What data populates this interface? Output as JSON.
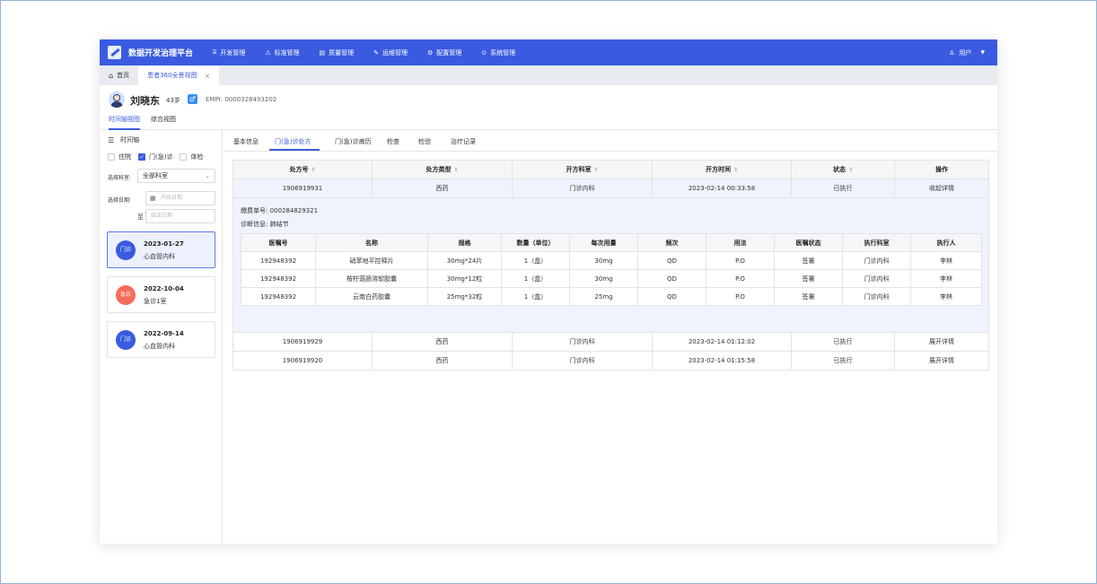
{
  "app": {
    "title": "数据开发治理平台",
    "nav": [
      {
        "label": "开发管理",
        "icon": "code-icon"
      },
      {
        "label": "标准管理",
        "icon": "standard-icon"
      },
      {
        "label": "质量管理",
        "icon": "quality-icon"
      },
      {
        "label": "运维管理",
        "icon": "wrench-icon"
      },
      {
        "label": "配置管理",
        "icon": "gear-icon"
      },
      {
        "label": "系统管理",
        "icon": "system-icon"
      }
    ],
    "user_label": "用户"
  },
  "page_tabs": {
    "home": "首页",
    "current": "患者360全景视图"
  },
  "patient": {
    "name": "刘晓东",
    "age": "43岁",
    "sex_symbol": "♂",
    "empi": "EMPI:  0000328493202"
  },
  "view_tabs": [
    "时间轴视图",
    "综合视图"
  ],
  "timeline": {
    "title": "时间轴",
    "filters": [
      {
        "label": "住院",
        "checked": false
      },
      {
        "label": "门(急)诊",
        "checked": true
      },
      {
        "label": "体检",
        "checked": false
      }
    ],
    "dept_label": "选择科室:",
    "dept_value": "全部科室",
    "date_label": "选择日期:",
    "date_start_placeholder": "开始日期",
    "date_to": "至",
    "date_end_placeholder": "结束日期",
    "visits": [
      {
        "badge": "门诊",
        "date": "2023-01-27",
        "dept": "心血管内科",
        "color": "#3a5be0"
      },
      {
        "badge": "急诊",
        "date": "2022-10-04",
        "dept": "急诊1室",
        "color": "#f56c5b"
      },
      {
        "badge": "门诊",
        "date": "2022-09-14",
        "dept": "心血管内科",
        "color": "#3a5be0"
      }
    ]
  },
  "record_tabs": [
    "基本信息",
    "门(急)诊处方",
    "门(急)诊病历",
    "检查",
    "检验",
    "治疗记录"
  ],
  "prescriptions": {
    "headers": [
      "处方号",
      "处方类型",
      "开方科室",
      "开方时间",
      "状态",
      "操作"
    ],
    "rows": [
      {
        "no": "1906919931",
        "type": "西药",
        "dept": "门诊内科",
        "time": "2023-02-14 00:33:58",
        "status": "已执行",
        "action": "收起详情"
      },
      {
        "no": "1906919929",
        "type": "西药",
        "dept": "门诊内科",
        "time": "2023-02-14 01:12:02",
        "status": "已执行",
        "action": "展开详情"
      },
      {
        "no": "1906919920",
        "type": "西药",
        "dept": "门诊内科",
        "time": "2023-02-14 01:15:58",
        "status": "已执行",
        "action": "展开详情"
      }
    ],
    "detail": {
      "bill_no": "缴费单号:  000284829321",
      "diagnosis": "诊断信息:  肺结节",
      "headers": [
        "医嘱号",
        "名称",
        "规格",
        "数量（单位）",
        "每次用量",
        "频次",
        "用法",
        "医嘱状态",
        "执行科室",
        "执行人"
      ],
      "rows": [
        [
          "192948392",
          "硝苯地平控释片",
          "30mg*24片",
          "1（盒）",
          "30mg",
          "QD",
          "P.O",
          "签署",
          "门诊内科",
          "李林"
        ],
        [
          "192948392",
          "桉柠蒎肠溶软胶囊",
          "30mg*12粒",
          "1（盒）",
          "30mg",
          "QD",
          "P.O",
          "签署",
          "门诊内科",
          "李林"
        ],
        [
          "192948392",
          "云南白药胶囊",
          "25mg*32粒",
          "1（盒）",
          "25mg",
          "QD",
          "P.O",
          "签署",
          "门诊内科",
          "李林"
        ]
      ]
    }
  }
}
